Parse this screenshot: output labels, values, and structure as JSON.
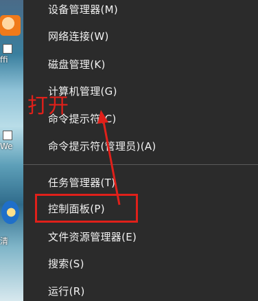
{
  "menu": {
    "items": [
      {
        "id": "device-manager",
        "label": "设备管理器(M)"
      },
      {
        "id": "network-connections",
        "label": "网络连接(W)"
      },
      {
        "id": "disk-management",
        "label": "磁盘管理(K)"
      },
      {
        "id": "computer-management",
        "label": "计算机管理(G)"
      },
      {
        "id": "command-prompt",
        "label": "命令提示符(C)"
      },
      {
        "id": "command-prompt-admin",
        "label": "命令提示符(管理员)(A)"
      },
      {
        "id": "task-manager",
        "label": "任务管理器(T)"
      },
      {
        "id": "control-panel",
        "label": "控制面板(P)"
      },
      {
        "id": "file-explorer",
        "label": "文件资源管理器(E)"
      },
      {
        "id": "search",
        "label": "搜索(S)"
      },
      {
        "id": "run",
        "label": "运行(R)"
      }
    ]
  },
  "annotation": {
    "text": "打开",
    "color": "#e0201a",
    "highlighted_item": "控制面板(P)"
  },
  "desktop": {
    "labels": [
      "ffi",
      "We",
      "清"
    ]
  },
  "colors": {
    "menu_background": "#2b2b2b",
    "menu_text": "#f2f2f2",
    "annotation": "#e0201a"
  }
}
